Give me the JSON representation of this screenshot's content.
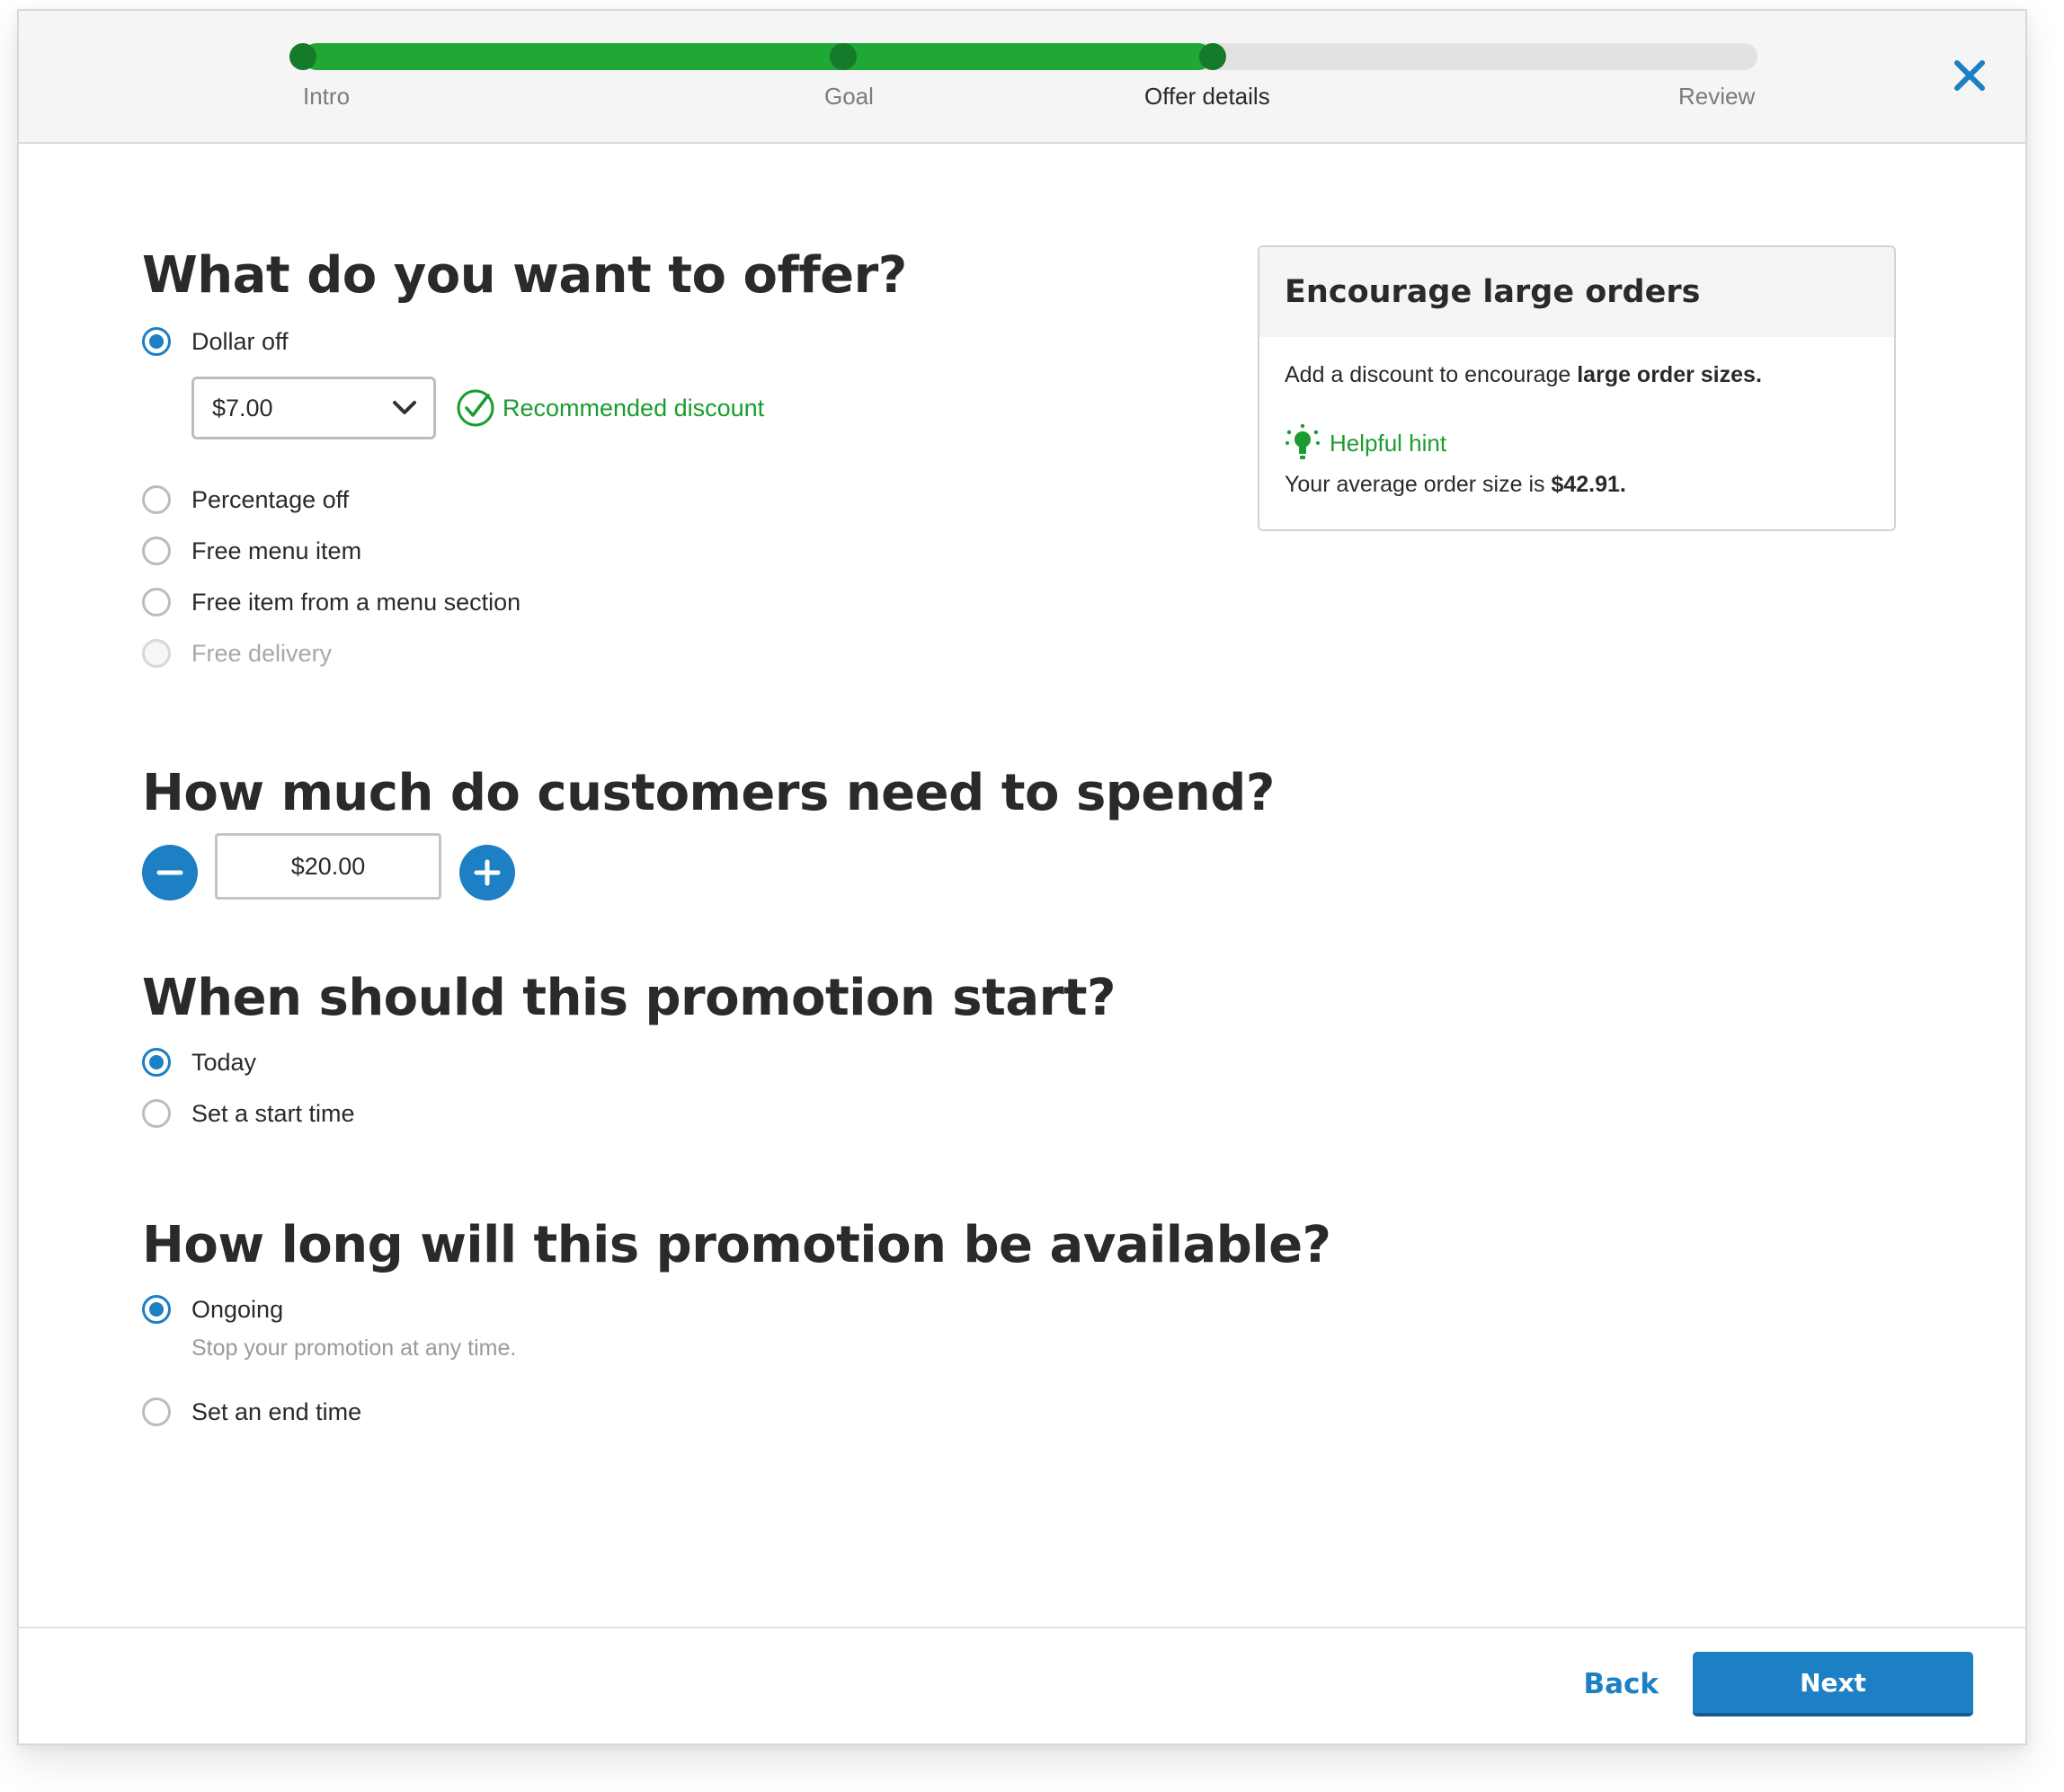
{
  "stepper": {
    "steps": [
      "Intro",
      "Goal",
      "Offer details",
      "Review"
    ],
    "current_step_index": 2,
    "progress_fraction": 0.625,
    "colors": {
      "fill": "#1fa836",
      "dot": "#157a2a",
      "track": "#e2e2e2"
    }
  },
  "close": {
    "icon": "close-icon"
  },
  "offer": {
    "title": "What do you want to offer?",
    "options": [
      {
        "label": "Dollar off",
        "checked": true,
        "disabled": false
      },
      {
        "label": "Percentage off",
        "checked": false,
        "disabled": false
      },
      {
        "label": "Free menu item",
        "checked": false,
        "disabled": false
      },
      {
        "label": "Free item from a menu section",
        "checked": false,
        "disabled": false
      },
      {
        "label": "Free delivery",
        "checked": false,
        "disabled": true
      }
    ],
    "amount_select": {
      "value": "$7.00",
      "icon": "chevron-down-icon"
    },
    "recommended_label": "Recommended discount",
    "recommended_icon": "check-circle-icon"
  },
  "spend": {
    "title": "How much do customers need to spend?",
    "value": "$20.00",
    "decrement_icon": "minus-icon",
    "increment_icon": "plus-icon"
  },
  "start": {
    "title": "When should this promotion start?",
    "options": [
      {
        "label": "Today",
        "checked": true
      },
      {
        "label": "Set a start time",
        "checked": false
      }
    ]
  },
  "duration": {
    "title": "How long will this promotion be available?",
    "options": [
      {
        "label": "Ongoing",
        "checked": true,
        "sublabel": "Stop your promotion at any time."
      },
      {
        "label": "Set an end time",
        "checked": false
      }
    ]
  },
  "card": {
    "title": "Encourage large orders",
    "body_prefix": "Add a discount to encourage ",
    "body_bold": "large order sizes.",
    "hint_label": "Helpful hint",
    "hint_icon": "lightbulb-icon",
    "avg_prefix": "Your average order size is ",
    "avg_value": "$42.91."
  },
  "footer": {
    "back_label": "Back",
    "next_label": "Next"
  },
  "colors": {
    "primary": "#1d7fc4",
    "success": "#1a9c2e"
  }
}
